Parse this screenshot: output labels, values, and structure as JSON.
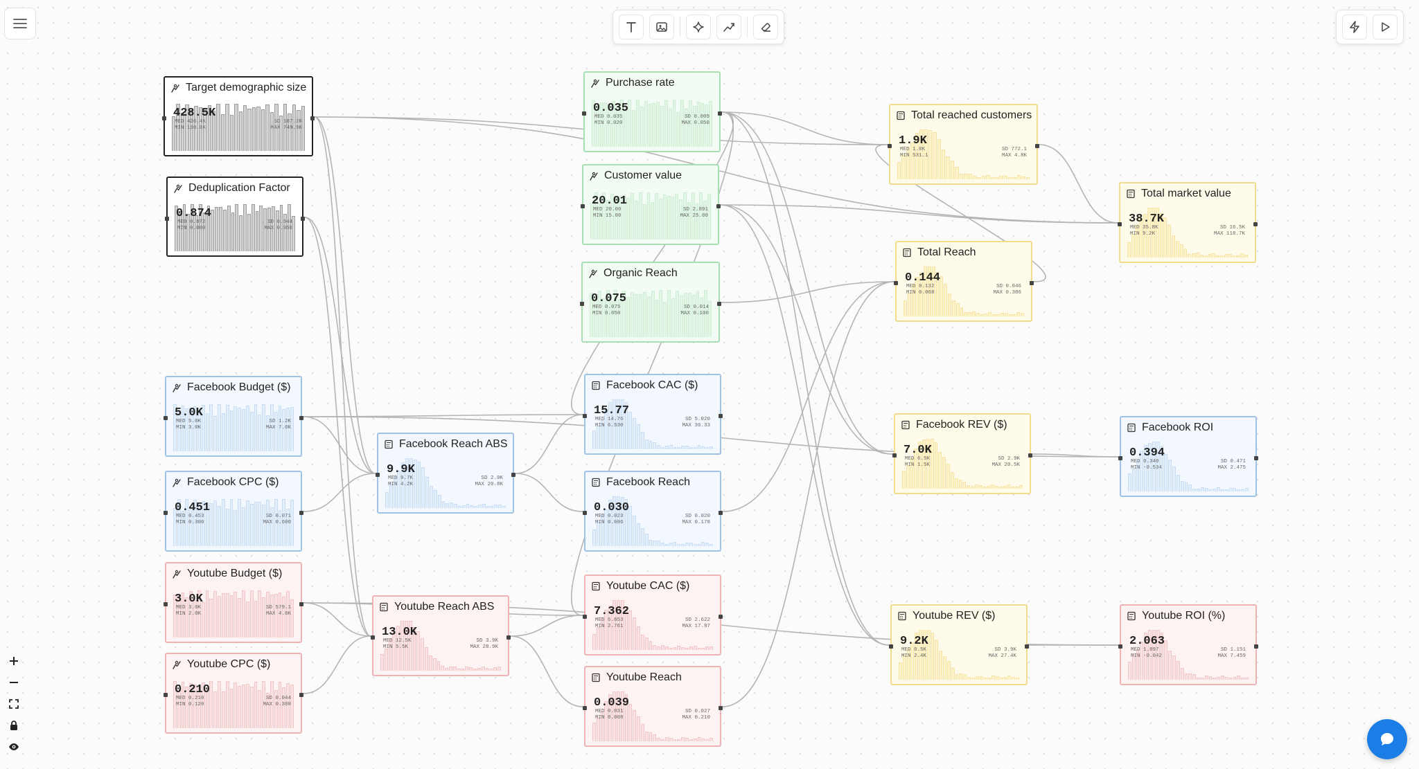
{
  "toolbar": {
    "tools": [
      {
        "name": "text-tool",
        "icon": "text-icon"
      },
      {
        "name": "image-tool",
        "icon": "image-icon"
      },
      {
        "name": "sparkle-tool",
        "icon": "sparkle-icon"
      },
      {
        "name": "connector-tool",
        "icon": "connector-icon"
      },
      {
        "name": "eraser-tool",
        "icon": "eraser-icon"
      }
    ],
    "right_tools": [
      {
        "name": "lightning-tool",
        "icon": "lightning-icon"
      },
      {
        "name": "run-tool",
        "icon": "play-icon"
      }
    ]
  },
  "zoom_controls": [
    "zoom-in",
    "zoom-out",
    "fit-view",
    "lock",
    "visibility"
  ],
  "colors": {
    "gray": "#222222",
    "green": "#a8dfb2",
    "blue": "#9ec3e6",
    "red": "#efb3b3",
    "yellow": "#f1dc8e",
    "chat": "#1a7ee6"
  },
  "nodes": [
    {
      "id": "target_demo",
      "title": "Target demographic size",
      "value": "428.5K",
      "med": "426.4K",
      "min": "110.0K",
      "sd": "187.2K",
      "max": "749.9K",
      "kind": "input",
      "color": "gray"
    },
    {
      "id": "dedup",
      "title": "Deduplication Factor",
      "value": "0.874",
      "med": "0.872",
      "min": "0.800",
      "sd": "0.044",
      "max": "0.950",
      "kind": "input",
      "color": "gray"
    },
    {
      "id": "purchase_rate",
      "title": "Purchase rate",
      "value": "0.035",
      "med": "0.035",
      "min": "0.020",
      "sd": "0.009",
      "max": "0.050",
      "kind": "input",
      "color": "green"
    },
    {
      "id": "customer_value",
      "title": "Customer value",
      "value": "20.01",
      "med": "20.00",
      "min": "15.00",
      "sd": "2.891",
      "max": "25.00",
      "kind": "input",
      "color": "green"
    },
    {
      "id": "organic_reach",
      "title": "Organic Reach",
      "value": "0.075",
      "med": "0.075",
      "min": "0.050",
      "sd": "0.014",
      "max": "0.100",
      "kind": "input",
      "color": "green"
    },
    {
      "id": "fb_budget",
      "title": "Facebook Budget ($)",
      "value": "5.0K",
      "med": "5.0K",
      "min": "3.0K",
      "sd": "1.2K",
      "max": "7.0K",
      "kind": "input",
      "color": "blue"
    },
    {
      "id": "fb_cpc",
      "title": "Facebook CPC ($)",
      "value": "0.451",
      "med": "0.453",
      "min": "0.300",
      "sd": "0.071",
      "max": "0.600",
      "kind": "input",
      "color": "blue"
    },
    {
      "id": "yt_budget",
      "title": "Youtube Budget ($)",
      "value": "3.0K",
      "med": "3.0K",
      "min": "2.0K",
      "sd": "579.1",
      "max": "4.0K",
      "kind": "input",
      "color": "red"
    },
    {
      "id": "yt_cpc",
      "title": "Youtube CPC ($)",
      "value": "0.210",
      "med": "0.210",
      "min": "0.120",
      "sd": "0.044",
      "max": "0.300",
      "kind": "input",
      "color": "red"
    },
    {
      "id": "fb_reach_abs",
      "title": "Facebook Reach ABS",
      "value": "9.9K",
      "med": "9.7K",
      "min": "4.2K",
      "sd": "2.9K",
      "max": "20.8K",
      "kind": "calc",
      "color": "blue"
    },
    {
      "id": "yt_reach_abs",
      "title": "Youtube Reach ABS",
      "value": "13.0K",
      "med": "12.5K",
      "min": "5.5K",
      "sd": "3.9K",
      "max": "28.9K",
      "kind": "calc",
      "color": "red"
    },
    {
      "id": "fb_cac",
      "title": "Facebook CAC ($)",
      "value": "15.77",
      "med": "14.76",
      "min": "6.530",
      "sd": "5.020",
      "max": "36.33",
      "kind": "calc",
      "color": "blue"
    },
    {
      "id": "fb_reach",
      "title": "Facebook Reach",
      "value": "0.030",
      "med": "0.023",
      "min": "0.006",
      "sd": "0.020",
      "max": "0.178",
      "kind": "calc",
      "color": "blue"
    },
    {
      "id": "yt_cac",
      "title": "Youtube CAC ($)",
      "value": "7.362",
      "med": "6.853",
      "min": "2.761",
      "sd": "2.622",
      "max": "17.97",
      "kind": "calc",
      "color": "red"
    },
    {
      "id": "yt_reach",
      "title": "Youtube Reach",
      "value": "0.039",
      "med": "0.031",
      "min": "0.008",
      "sd": "0.027",
      "max": "0.210",
      "kind": "calc",
      "color": "red"
    },
    {
      "id": "total_customers",
      "title": "Total reached customers",
      "value": "1.9K",
      "med": "1.8K",
      "min": "531.1",
      "sd": "772.1",
      "max": "4.8K",
      "kind": "calc",
      "color": "yellow"
    },
    {
      "id": "total_reach",
      "title": "Total Reach",
      "value": "0.144",
      "med": "0.132",
      "min": "0.068",
      "sd": "0.046",
      "max": "0.386",
      "kind": "calc",
      "color": "yellow"
    },
    {
      "id": "fb_rev",
      "title": "Facebook REV ($)",
      "value": "7.0K",
      "med": "6.5K",
      "min": "1.5K",
      "sd": "2.9K",
      "max": "20.5K",
      "kind": "calc",
      "color": "yellow"
    },
    {
      "id": "yt_rev",
      "title": "Youtube REV ($)",
      "value": "9.2K",
      "med": "8.5K",
      "min": "2.4K",
      "sd": "3.9K",
      "max": "27.4K",
      "kind": "calc",
      "color": "yellow"
    },
    {
      "id": "total_market",
      "title": "Total market value",
      "value": "38.7K",
      "med": "35.8K",
      "min": "9.2K",
      "sd": "16.5K",
      "max": "118.7K",
      "kind": "calc",
      "color": "yellow"
    },
    {
      "id": "fb_roi",
      "title": "Facebook ROI",
      "value": "0.394",
      "med": "0.340",
      "min": "-0.534",
      "sd": "0.471",
      "max": "2.475",
      "kind": "calc",
      "color": "blue"
    },
    {
      "id": "yt_roi",
      "title": "Youtube ROI (%)",
      "value": "2.063",
      "med": "1.897",
      "min": "-0.042",
      "sd": "1.151",
      "max": "7.459",
      "kind": "calc",
      "color": "red"
    }
  ],
  "edges": [
    [
      "target_demo",
      "fb_reach_abs"
    ],
    [
      "target_demo",
      "yt_reach_abs"
    ],
    [
      "target_demo",
      "total_customers"
    ],
    [
      "target_demo",
      "total_market"
    ],
    [
      "dedup",
      "fb_reach_abs"
    ],
    [
      "dedup",
      "yt_reach_abs"
    ],
    [
      "purchase_rate",
      "total_customers"
    ],
    [
      "purchase_rate",
      "fb_cac"
    ],
    [
      "purchase_rate",
      "yt_cac"
    ],
    [
      "purchase_rate",
      "fb_rev"
    ],
    [
      "purchase_rate",
      "yt_rev"
    ],
    [
      "customer_value",
      "total_market"
    ],
    [
      "customer_value",
      "fb_rev"
    ],
    [
      "customer_value",
      "yt_rev"
    ],
    [
      "organic_reach",
      "total_reach"
    ],
    [
      "fb_budget",
      "fb_reach_abs"
    ],
    [
      "fb_budget",
      "fb_cac"
    ],
    [
      "fb_budget",
      "fb_roi"
    ],
    [
      "fb_cpc",
      "fb_reach_abs"
    ],
    [
      "yt_budget",
      "yt_reach_abs"
    ],
    [
      "yt_budget",
      "yt_cac"
    ],
    [
      "yt_budget",
      "yt_roi"
    ],
    [
      "yt_cpc",
      "yt_reach_abs"
    ],
    [
      "fb_reach_abs",
      "fb_reach"
    ],
    [
      "fb_reach_abs",
      "fb_cac"
    ],
    [
      "yt_reach_abs",
      "yt_reach"
    ],
    [
      "yt_reach_abs",
      "yt_cac"
    ],
    [
      "fb_reach",
      "total_reach"
    ],
    [
      "yt_reach",
      "total_reach"
    ],
    [
      "total_reach",
      "total_customers"
    ],
    [
      "total_customers",
      "total_market"
    ],
    [
      "fb_rev",
      "fb_roi"
    ],
    [
      "yt_rev",
      "yt_roi"
    ]
  ]
}
